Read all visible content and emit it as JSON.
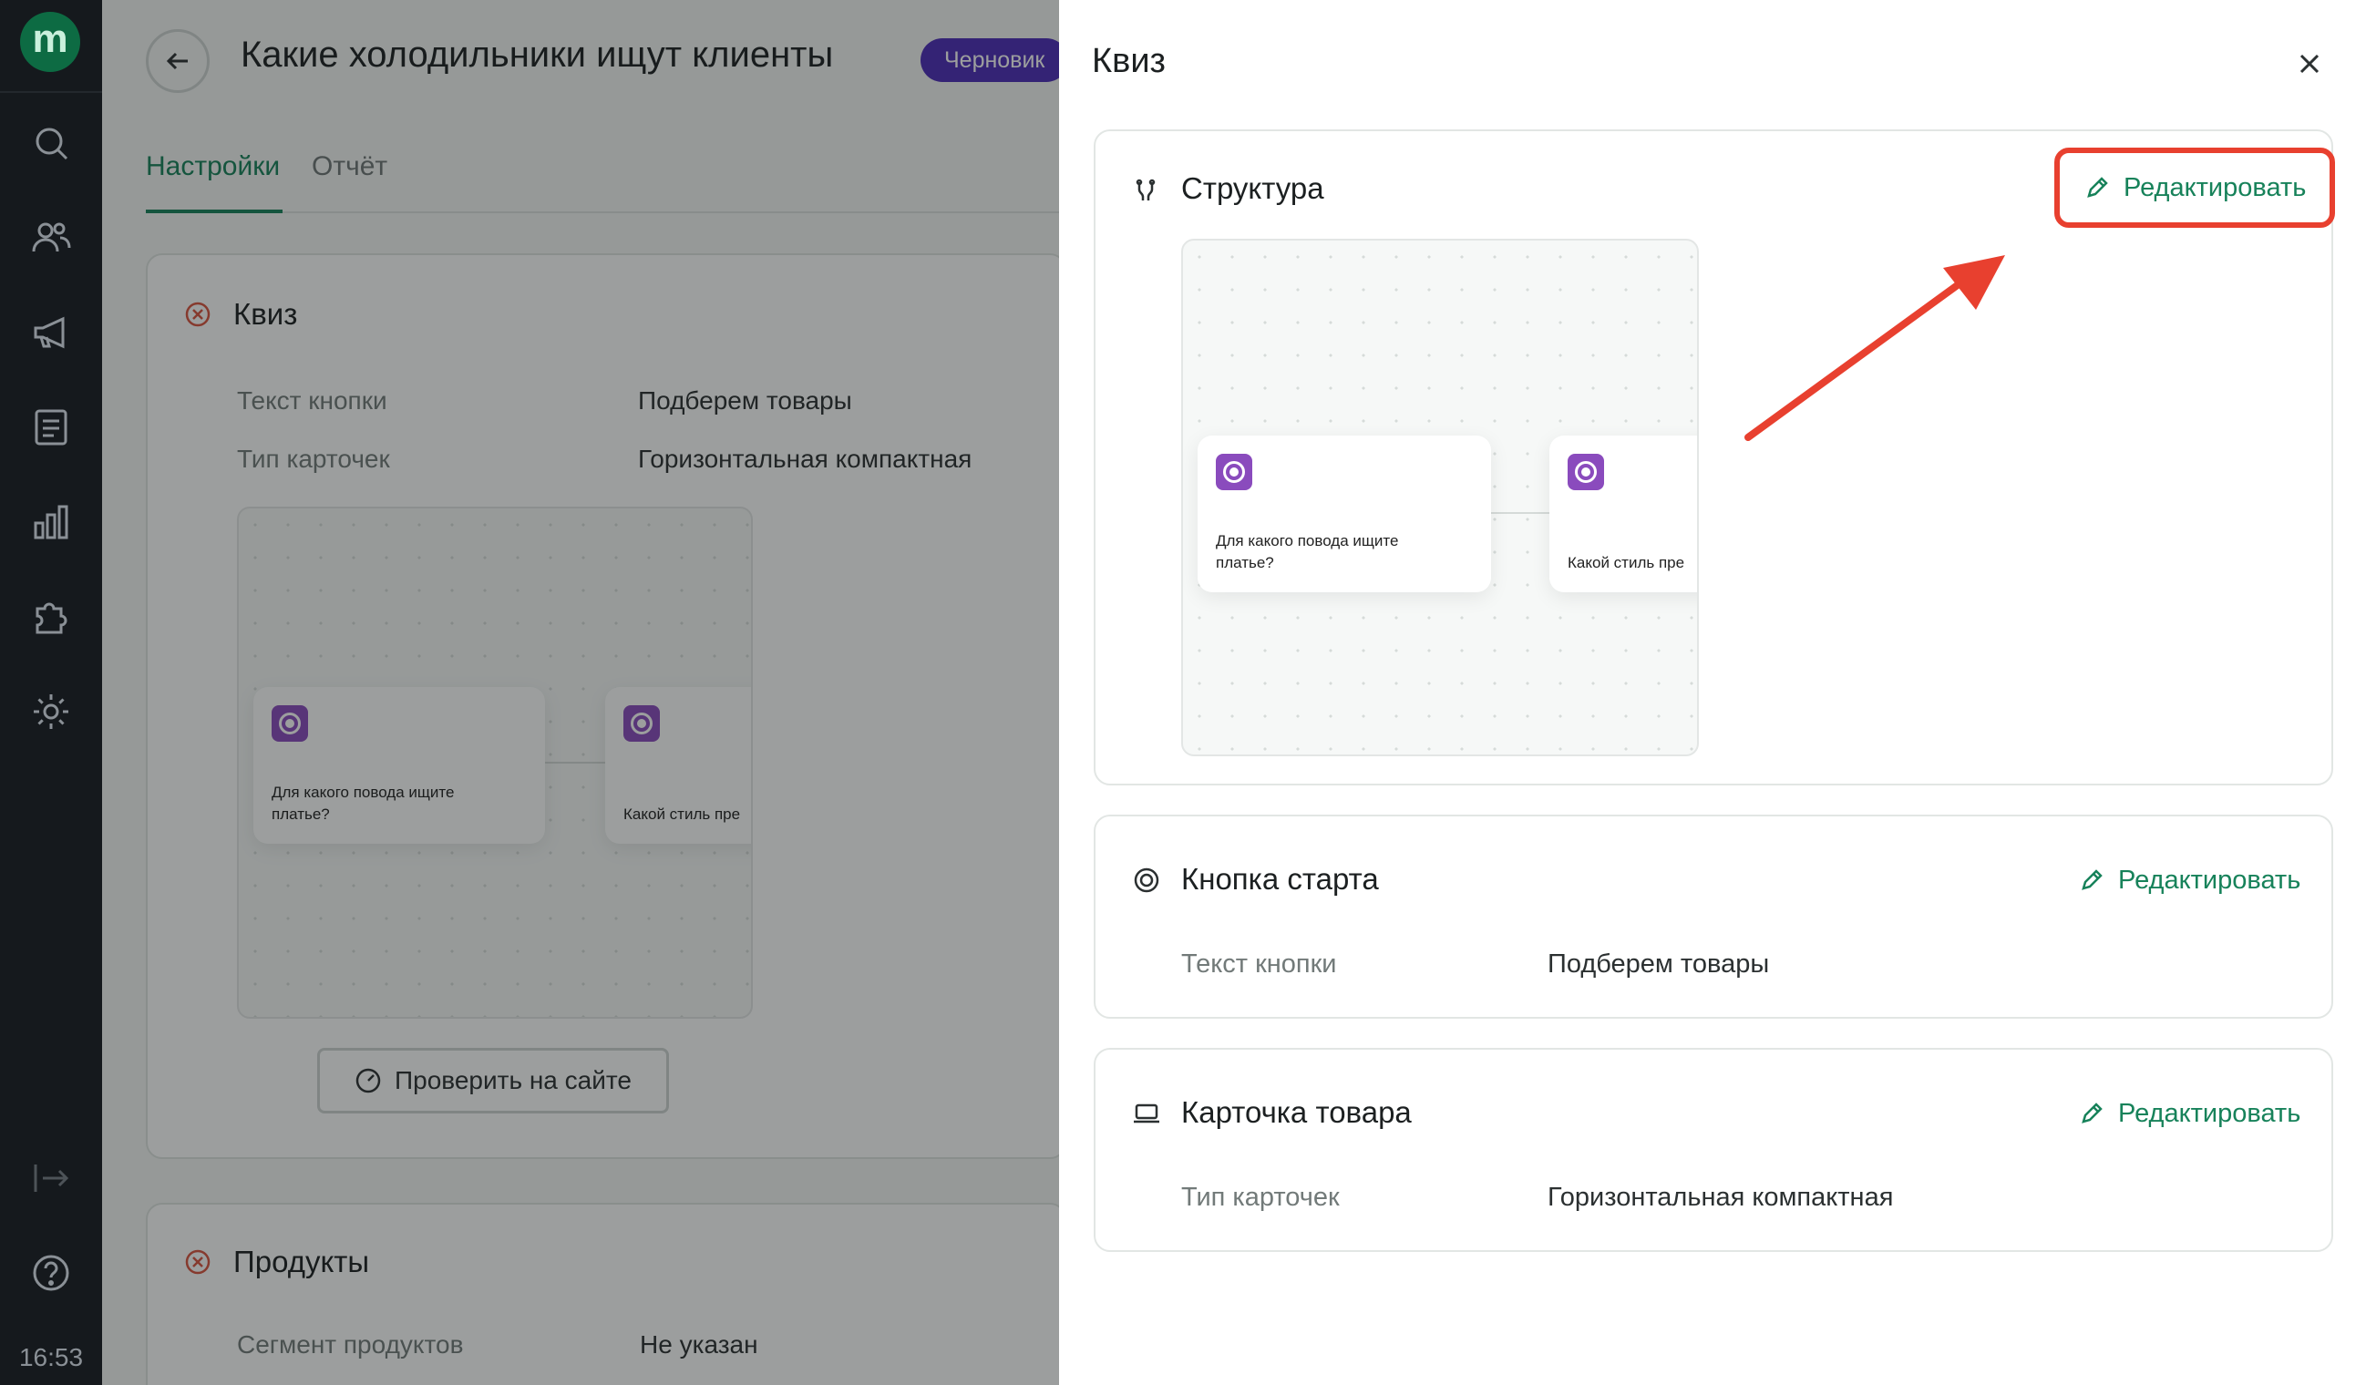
{
  "sidebar": {
    "logo_letter": "m",
    "icons": [
      "search-icon",
      "users-icon",
      "megaphone-icon",
      "document-icon",
      "chart-icon",
      "puzzle-icon",
      "gear-icon",
      "exit-icon",
      "help-icon"
    ],
    "clock": "16:53"
  },
  "page": {
    "title": "Какие холодильники ищут клиенты",
    "status_badge": "Черновик",
    "tabs": [
      {
        "label": "Настройки"
      },
      {
        "label": "Отчёт"
      }
    ],
    "quiz_card": {
      "title": "Квиз",
      "rows": [
        {
          "label": "Текст кнопки",
          "value": "Подберем товары"
        },
        {
          "label": "Тип карточек",
          "value": "Горизонтальная компактная"
        }
      ],
      "check_button": "Проверить на сайте"
    },
    "products_card": {
      "title": "Продукты",
      "rows": [
        {
          "label": "Сегмент продуктов",
          "value": "Не указан"
        }
      ]
    }
  },
  "preview_nodes": [
    {
      "text": "Для какого повода ищите платье?"
    },
    {
      "text": "Какой стиль пре"
    }
  ],
  "drawer": {
    "title": "Квиз",
    "edit_label": "Редактировать",
    "structure": {
      "title": "Структура"
    },
    "start_button": {
      "title": "Кнопка старта",
      "label": "Текст кнопки",
      "value": "Подберем товары"
    },
    "product_card": {
      "title": "Карточка товара",
      "label": "Тип карточек",
      "value": "Горизонтальная компактная"
    }
  },
  "colors": {
    "accent": "#17825a",
    "badge": "#4d2bb8",
    "highlight": "#e8402f",
    "node_icon": "#8a4bbd"
  }
}
